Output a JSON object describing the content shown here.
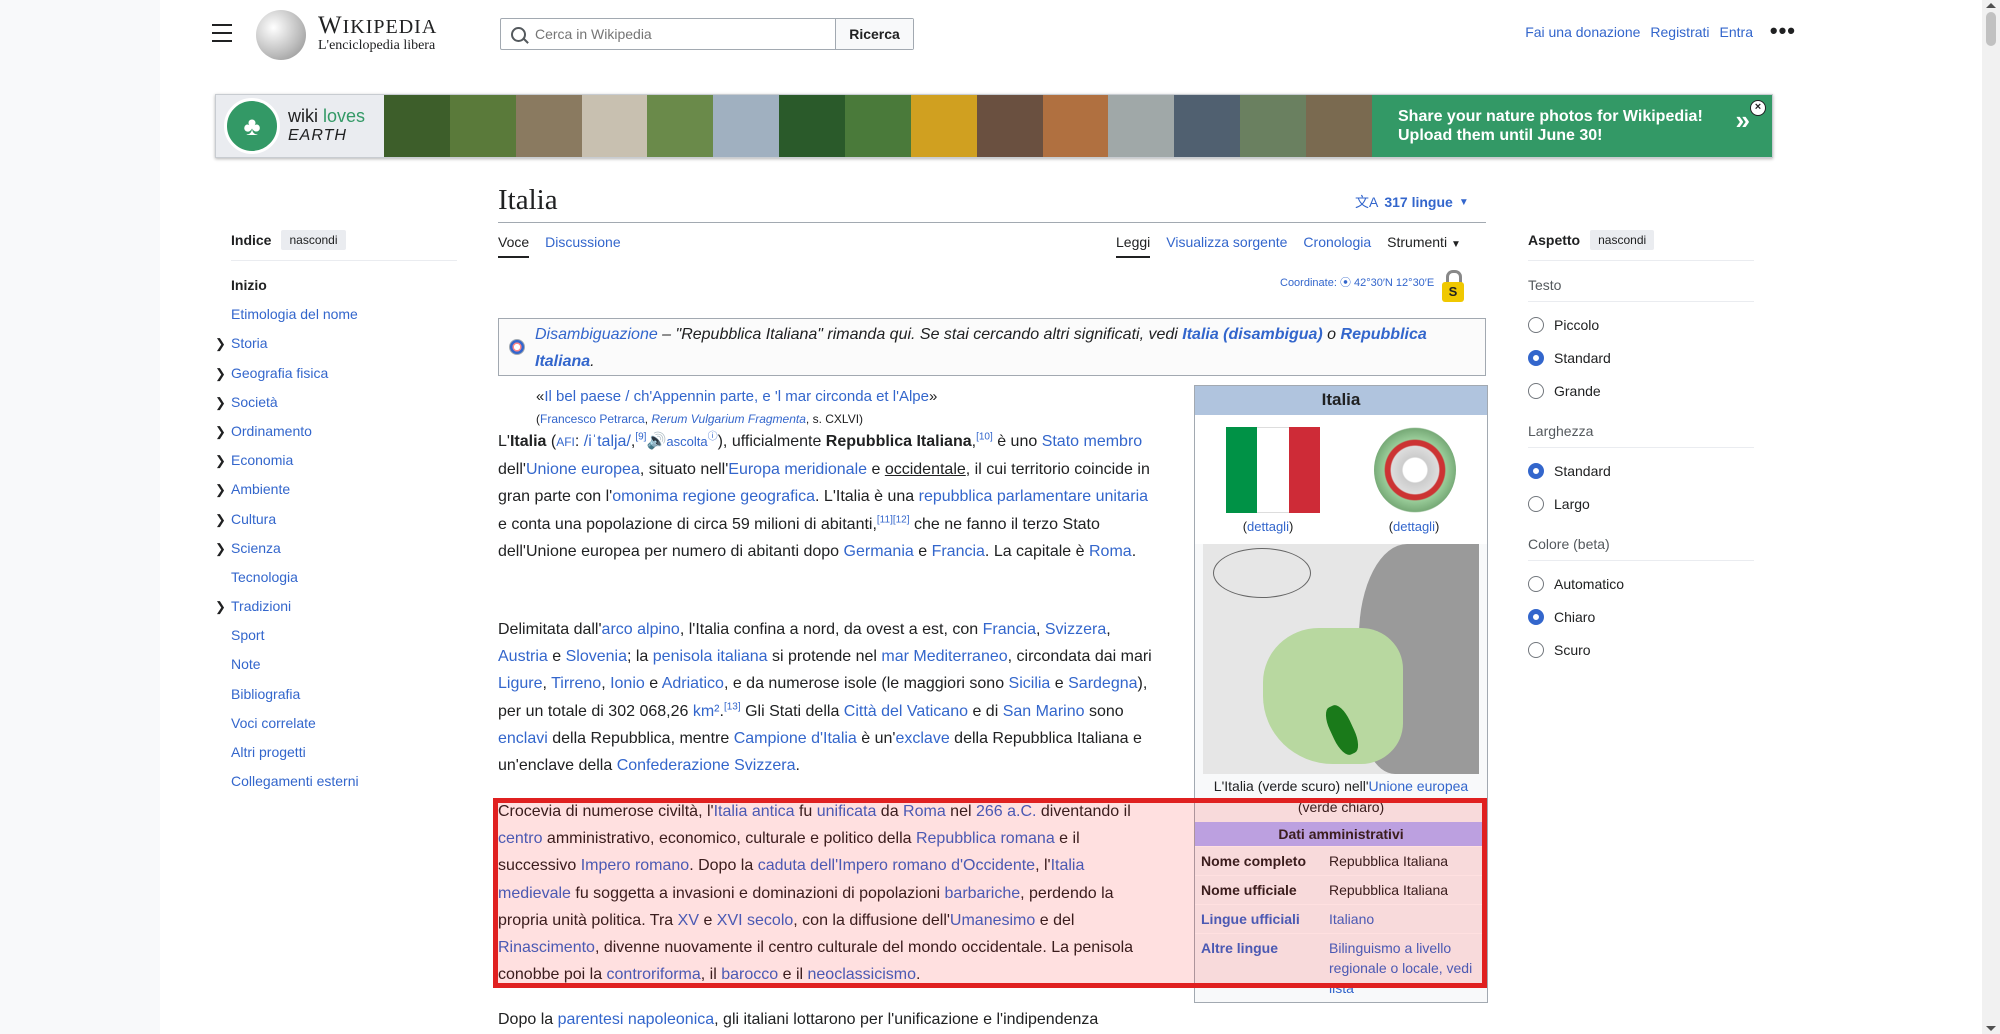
{
  "header": {
    "wordmark": "Wikipedia",
    "tagline": "L'enciclopedia libera",
    "search_placeholder": "Cerca in Wikipedia",
    "search_button": "Ricerca",
    "links": [
      "Fai una donazione",
      "Registrati",
      "Entra"
    ],
    "more": "•••"
  },
  "banner": {
    "logo_line1a": "wiki",
    "logo_line1b": "loves",
    "logo_line2": "EARTH",
    "cta_line1": "Share your nature photos for Wikipedia!",
    "cta_line2": "Upload them until June 30!",
    "chevron": "»",
    "close": "×",
    "photo_colors": [
      "#3d5e2a",
      "#5a7a3a",
      "#8a7a60",
      "#c8c0b0",
      "#6a8a4a",
      "#a0b0c0",
      "#2a5a2a",
      "#4a7a3a",
      "#d0a020",
      "#6a5040",
      "#b07040",
      "#a0a8a8",
      "#506070",
      "#6a8060",
      "#7a6a50"
    ]
  },
  "toc": {
    "title": "Indice",
    "hide": "nascondi",
    "items": [
      {
        "label": "Inizio",
        "bold": true,
        "chevron": false
      },
      {
        "label": "Etimologia del nome",
        "chevron": false
      },
      {
        "label": "Storia",
        "chevron": true
      },
      {
        "label": "Geografia fisica",
        "chevron": true
      },
      {
        "label": "Società",
        "chevron": true
      },
      {
        "label": "Ordinamento",
        "chevron": true
      },
      {
        "label": "Economia",
        "chevron": true
      },
      {
        "label": "Ambiente",
        "chevron": true
      },
      {
        "label": "Cultura",
        "chevron": true
      },
      {
        "label": "Scienza",
        "chevron": true
      },
      {
        "label": "Tecnologia",
        "chevron": false
      },
      {
        "label": "Tradizioni",
        "chevron": true
      },
      {
        "label": "Sport",
        "chevron": false
      },
      {
        "label": "Note",
        "chevron": false
      },
      {
        "label": "Bibliografia",
        "chevron": false
      },
      {
        "label": "Voci correlate",
        "chevron": false
      },
      {
        "label": "Altri progetti",
        "chevron": false
      },
      {
        "label": "Collegamenti esterni",
        "chevron": false
      }
    ]
  },
  "article": {
    "title": "Italia",
    "languages": "317 lingue",
    "tabs_left": [
      "Voce",
      "Discussione"
    ],
    "tabs_right": [
      "Leggi",
      "Visualizza sorgente",
      "Cronologia",
      "Strumenti"
    ],
    "coords_label": "Coordinate:",
    "coords_value": "42°30′N 12°30′E",
    "lock_letter": "S"
  },
  "infobox": {
    "title": "Italia",
    "flag_colors": [
      "#009246",
      "#ffffff",
      "#ce2b37"
    ],
    "cap_flag": "dettagli",
    "cap_emblem": "dettagli",
    "map_caption_1": "L'Italia (verde scuro) nell'",
    "map_caption_link": "Unione europea",
    "map_caption_2": " (verde chiaro)",
    "section": "Dati amministrativi",
    "rows": [
      {
        "k": "Nome completo",
        "v": "Repubblica Italiana"
      },
      {
        "k": "Nome ufficiale",
        "v": "Repubblica Italiana"
      },
      {
        "k": "Lingue ufficiali",
        "v": "Italiano"
      },
      {
        "k": "Altre lingue",
        "v": "Bilinguismo a livello regionale o locale, vedi lista"
      }
    ]
  },
  "appearance": {
    "title": "Aspetto",
    "hide": "nascondi",
    "groups": [
      {
        "title": "Testo",
        "options": [
          "Piccolo",
          "Standard",
          "Grande"
        ],
        "selected": 1
      },
      {
        "title": "Larghezza",
        "options": [
          "Standard",
          "Largo"
        ],
        "selected": 0
      },
      {
        "title": "Colore (beta)",
        "options": [
          "Automatico",
          "Chiaro",
          "Scuro"
        ],
        "selected": 1
      }
    ]
  }
}
